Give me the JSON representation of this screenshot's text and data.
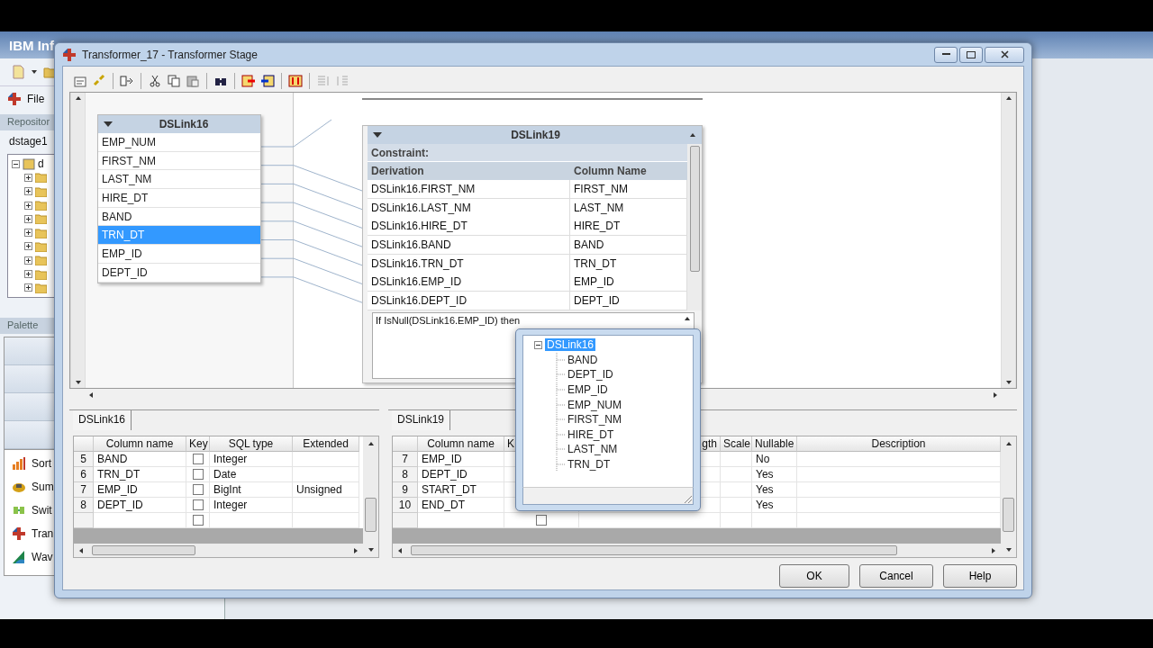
{
  "app": {
    "title": "IBM Inf",
    "menu": [
      {
        "label": "File"
      }
    ],
    "repository": {
      "title": "Repositor",
      "root": "dstage1",
      "project": "d"
    },
    "palette": {
      "title": "Palette",
      "items": [
        {
          "label": "Sort"
        },
        {
          "label": "Sum"
        },
        {
          "label": "Swit"
        },
        {
          "label": "Tran"
        },
        {
          "label": "Wav"
        }
      ]
    }
  },
  "dialog": {
    "title": "Transformer_17 - Transformer Stage",
    "input_link": {
      "name": "DSLink16",
      "columns": [
        {
          "name": "EMP_NUM",
          "selected": false
        },
        {
          "name": "FIRST_NM",
          "selected": false
        },
        {
          "name": "LAST_NM",
          "selected": false
        },
        {
          "name": "HIRE_DT",
          "selected": false
        },
        {
          "name": "BAND",
          "selected": false
        },
        {
          "name": "TRN_DT",
          "selected": true
        },
        {
          "name": "EMP_ID",
          "selected": false
        },
        {
          "name": "DEPT_ID",
          "selected": false
        }
      ]
    },
    "output_link": {
      "name": "DSLink19",
      "constraint": "Constraint:",
      "headers": [
        "Derivation",
        "Column Name"
      ],
      "rows": [
        {
          "derivation": "DSLink16.FIRST_NM",
          "column": "FIRST_NM"
        },
        {
          "derivation": "DSLink16.LAST_NM",
          "column": "LAST_NM"
        },
        {
          "derivation": "DSLink16.HIRE_DT",
          "column": "HIRE_DT"
        },
        {
          "derivation": "DSLink16.BAND",
          "column": "BAND"
        },
        {
          "derivation": "DSLink16.TRN_DT",
          "column": "TRN_DT"
        },
        {
          "derivation": "DSLink16.EMP_ID",
          "column": "EMP_ID"
        },
        {
          "derivation": "DSLink16.DEPT_ID",
          "column": "DEPT_ID"
        }
      ],
      "expression": "If IsNull(DSLink16.EMP_ID) then"
    },
    "expression_menu": {
      "root": "DSLink16",
      "expanded": true,
      "selected": true,
      "children": [
        {
          "label": "BAND"
        },
        {
          "label": "DEPT_ID"
        },
        {
          "label": "EMP_ID"
        },
        {
          "label": "EMP_NUM"
        },
        {
          "label": "FIRST_NM"
        },
        {
          "label": "HIRE_DT"
        },
        {
          "label": "LAST_NM"
        },
        {
          "label": "TRN_DT"
        }
      ]
    },
    "input_grid": {
      "tab": "DSLink16",
      "columns": [
        "Column name",
        "Key",
        "SQL type",
        "Extended"
      ],
      "rows": [
        {
          "num": "5",
          "name": "BAND",
          "key": false,
          "sql_type": "Integer"
        },
        {
          "num": "6",
          "name": "TRN_DT",
          "key": false,
          "sql_type": "Date"
        },
        {
          "num": "7",
          "name": "EMP_ID",
          "key": false,
          "sql_type": "BigInt",
          "extended": "Unsigned"
        },
        {
          "num": "8",
          "name": "DEPT_ID",
          "key": false,
          "sql_type": "Integer"
        }
      ],
      "new_row": {
        "key": false
      }
    },
    "output_grid": {
      "tab": "DSLink19",
      "columns": [
        "Column name",
        "K",
        "gth",
        "Scale",
        "Nullable",
        "Description"
      ],
      "rows": [
        {
          "num": "7",
          "name": "EMP_ID",
          "nullable": "No"
        },
        {
          "num": "8",
          "name": "DEPT_ID",
          "nullable": "Yes"
        },
        {
          "num": "9",
          "name": "START_DT",
          "nullable": "Yes"
        },
        {
          "num": "10",
          "name": "END_DT",
          "nullable": "Yes"
        }
      ],
      "new_row": {
        "key": false
      }
    },
    "buttons": [
      "OK",
      "Cancel",
      "Help"
    ]
  }
}
